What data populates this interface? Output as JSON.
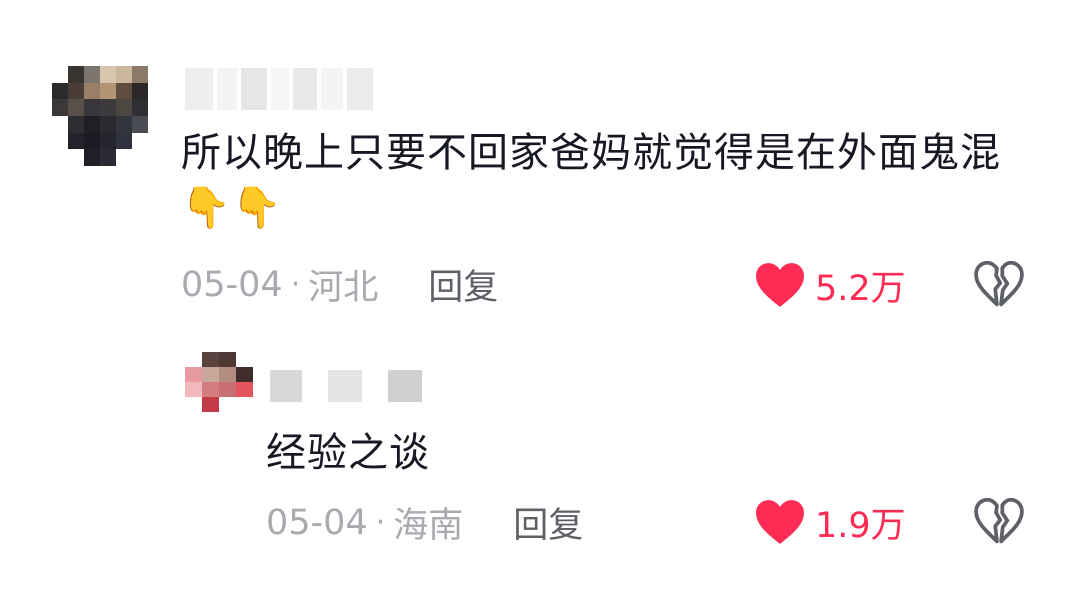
{
  "comments": [
    {
      "text": "所以晚上只要不回家爸妈就觉得是在外面鬼混👇👇",
      "date": "05-04",
      "location": "河北",
      "separator": "·",
      "reply_label": "回复",
      "likes": "5.2万"
    },
    {
      "text": "经验之谈",
      "date": "05-04",
      "location": "海南",
      "separator": "·",
      "reply_label": "回复",
      "likes": "1.9万"
    }
  ],
  "icons": {
    "like": "heart-icon",
    "dislike": "broken-heart-icon",
    "emoji": "backhand-index-pointing-down"
  },
  "colors": {
    "like_red": "#fe2c55",
    "meta_gray": "#a9aab0",
    "reply_gray": "#5e6068",
    "icon_outline": "#5e6068"
  }
}
